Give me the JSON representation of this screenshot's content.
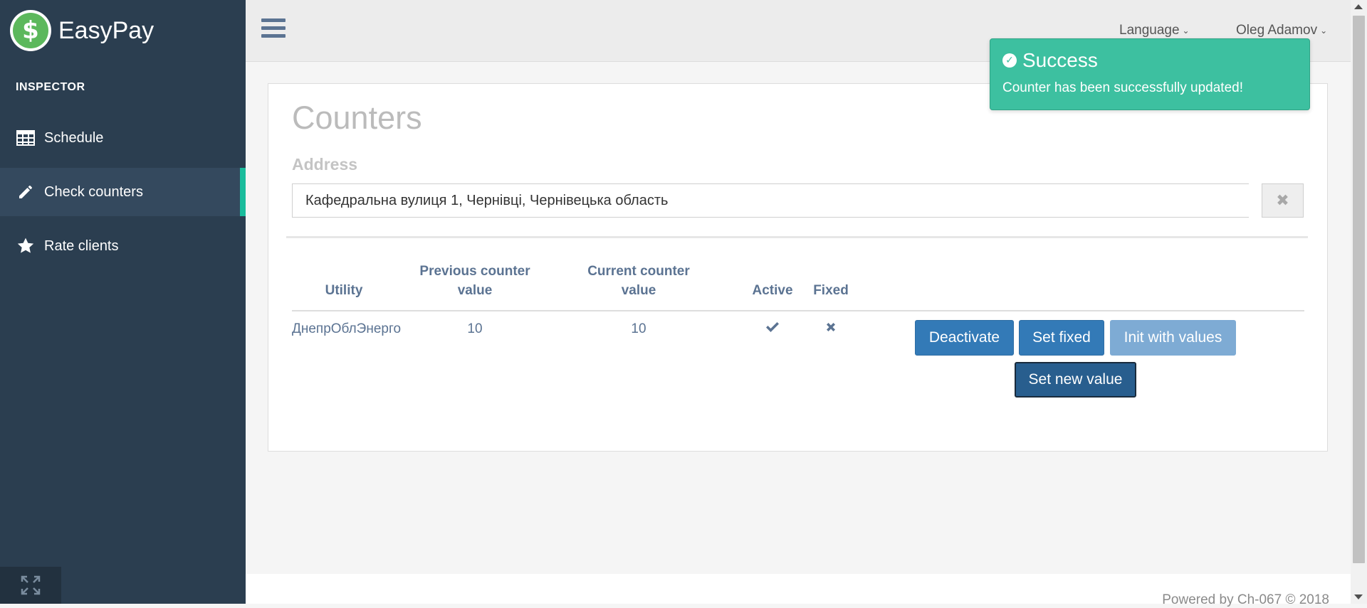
{
  "brand": {
    "name": "EasyPay",
    "logo_icon": "dollar-icon",
    "accent": "#5cb85c"
  },
  "sidebar": {
    "section_title": "INSPECTOR",
    "items": [
      {
        "label": "Schedule",
        "icon": "table-icon",
        "active": false
      },
      {
        "label": "Check counters",
        "icon": "pencil-icon",
        "active": true
      },
      {
        "label": "Rate clients",
        "icon": "star-icon",
        "active": false
      }
    ],
    "active_accent": "#1abc9c",
    "expand_icon": "expand-icon"
  },
  "topbar": {
    "menu_icon": "hamburger-icon",
    "language_label": "Language",
    "user_name": "Oleg Adamov"
  },
  "main": {
    "title": "Counters",
    "address_label": "Address",
    "address_value": "Кафедральна вулиця 1, Чернівці, Чернівецька область",
    "table": {
      "headers": {
        "utility": "Utility",
        "previous_line1": "Previous counter",
        "previous_line2": "value",
        "current_line1": "Current counter",
        "current_line2": "value",
        "active": "Active",
        "fixed": "Fixed"
      },
      "rows": [
        {
          "utility": "ДнепрОблЭнерго",
          "previous_value": "10",
          "current_value": "10",
          "active_icon": "check-icon",
          "fixed_icon": "cross-icon",
          "actions": {
            "deactivate": "Deactivate",
            "set_fixed": "Set fixed",
            "init_with_values": "Init with values",
            "set_new_value": "Set new value"
          }
        }
      ]
    }
  },
  "toast": {
    "title": "Success",
    "message": "Counter has been successfully updated!",
    "color": "#3dc0a0"
  },
  "footer": {
    "text": "Powered by Ch-067 © 2018"
  }
}
